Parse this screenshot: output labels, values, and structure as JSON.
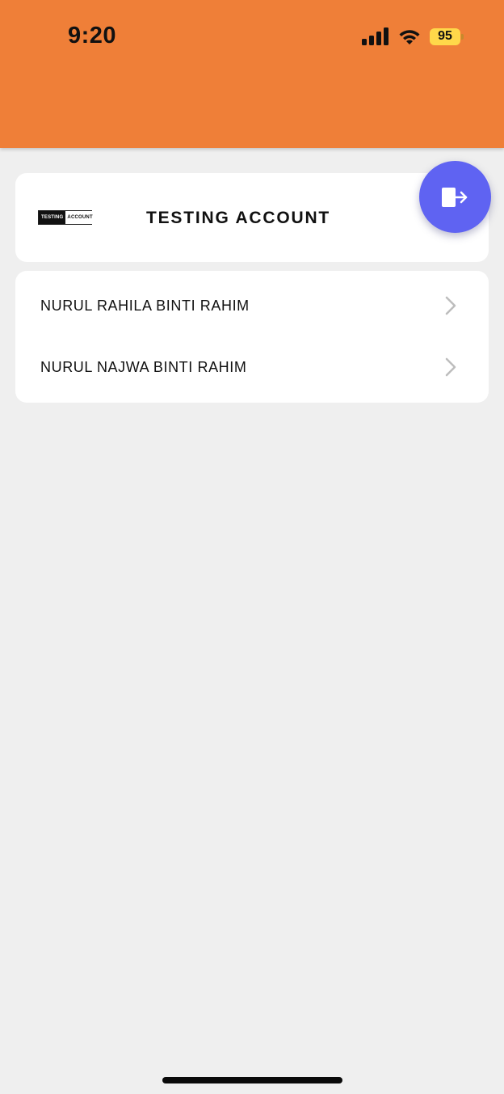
{
  "status_bar": {
    "time": "9:20",
    "battery": "95",
    "icons": [
      "signal-icon",
      "wifi-icon",
      "battery-icon"
    ]
  },
  "colors": {
    "header": "#ef7f38",
    "background": "#efefef",
    "card": "#ffffff",
    "fab": "#5f63f2",
    "battery": "#ffd84a"
  },
  "account": {
    "logo_text_left": "TESTING",
    "logo_text_right": "ACCOUNT",
    "title": "TESTING ACCOUNT"
  },
  "logout_button": {
    "icon": "logout-icon"
  },
  "students": [
    {
      "name": "NURUL RAHILA BINTI RAHIM",
      "icon": "chevron-right-icon"
    },
    {
      "name": "NURUL NAJWA BINTI RAHIM",
      "icon": "chevron-right-icon"
    }
  ]
}
